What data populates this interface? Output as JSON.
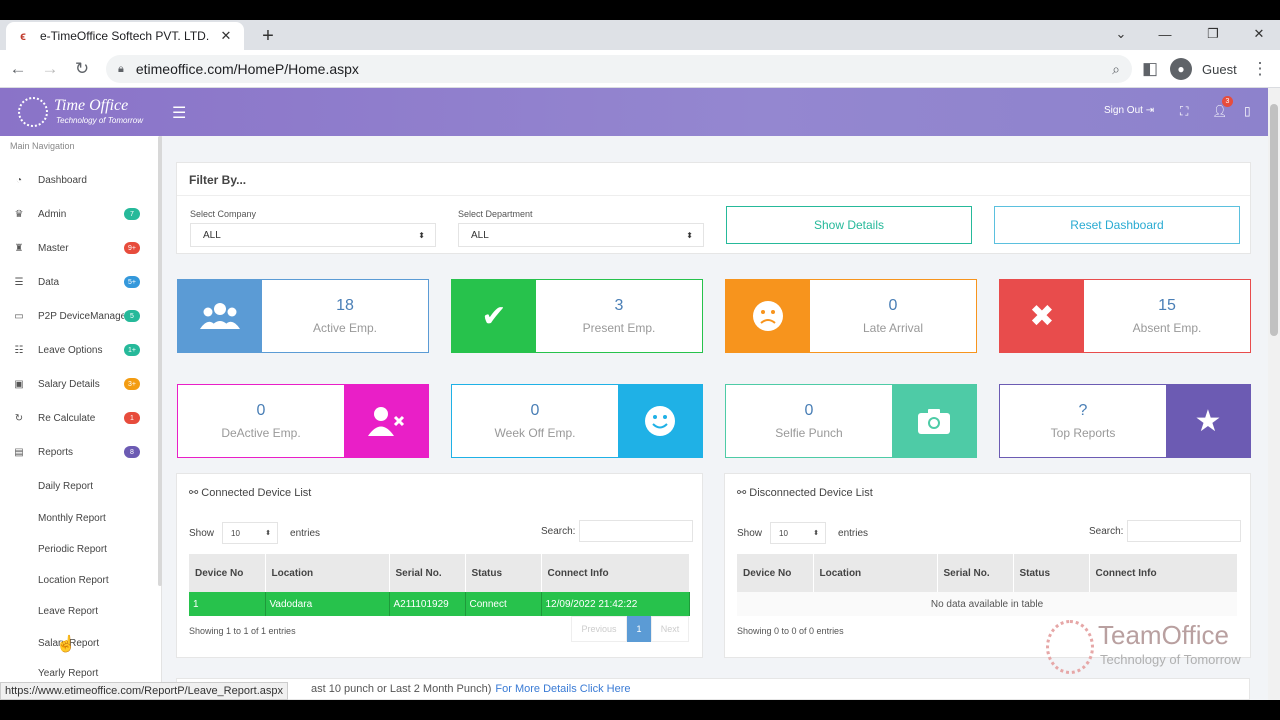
{
  "browser": {
    "tab_title": "e-TimeOffice Softech PVT. LTD.",
    "url": "etimeoffice.com/HomeP/Home.aspx",
    "profile_label": "Guest",
    "status_url": "https://www.etimeoffice.com/ReportP/Leave_Report.aspx"
  },
  "header": {
    "logo_name": "Time Office",
    "logo_tagline": "Technology of Tomorrow",
    "sign_out": "Sign Out",
    "notification_count": "3"
  },
  "sidebar": {
    "section_label": "Main Navigation",
    "items": [
      {
        "label": "Dashboard",
        "icon": "dashboard-icon",
        "count": ""
      },
      {
        "label": "Admin",
        "icon": "admin-icon",
        "count": "7",
        "color": "#26b99a"
      },
      {
        "label": "Master",
        "icon": "master-icon",
        "count": "9+",
        "color": "#e74c3c"
      },
      {
        "label": "Data",
        "icon": "database-icon",
        "count": "5+",
        "color": "#3498db"
      },
      {
        "label": "P2P DeviceManage",
        "icon": "monitor-icon",
        "count": "5",
        "color": "#26b99a"
      },
      {
        "label": "Leave Options",
        "icon": "list-icon",
        "count": "1+",
        "color": "#26b99a"
      },
      {
        "label": "Salary Details",
        "icon": "money-icon",
        "count": "3+",
        "color": "#f39c12"
      },
      {
        "label": "Re Calculate",
        "icon": "refresh-icon",
        "count": "1",
        "color": "#e74c3c"
      },
      {
        "label": "Reports",
        "icon": "report-icon",
        "count": "8",
        "color": "#6c5bb3"
      }
    ],
    "subitems": [
      "Daily Report",
      "Monthly Report",
      "Periodic Report",
      "Location Report",
      "Leave Report",
      "Salary Report",
      "Yearly Report"
    ]
  },
  "filter": {
    "title": "Filter By...",
    "company_label": "Select Company",
    "company_value": "ALL",
    "department_label": "Select Department",
    "department_value": "ALL",
    "show_details": "Show Details",
    "reset_dashboard": "Reset Dashboard"
  },
  "stats": [
    {
      "value": "18",
      "label": "Active Emp.",
      "color": "#5b9bd5",
      "icon": "users-icon"
    },
    {
      "value": "3",
      "label": "Present Emp.",
      "color": "#27c24c",
      "icon": "check-icon"
    },
    {
      "value": "0",
      "label": "Late Arrival",
      "color": "#f7941d",
      "icon": "frown-icon"
    },
    {
      "value": "15",
      "label": "Absent Emp.",
      "color": "#e84c4c",
      "icon": "x-icon"
    },
    {
      "value": "0",
      "label": "DeActive Emp.",
      "color": "#e91fc7",
      "icon": "user-remove-icon"
    },
    {
      "value": "0",
      "label": "Week Off Emp.",
      "color": "#1fb1e6",
      "icon": "smile-icon"
    },
    {
      "value": "0",
      "label": "Selfie Punch",
      "color": "#4ecba6",
      "icon": "camera-icon"
    },
    {
      "value": "?",
      "label": "Top Reports",
      "color": "#6c5bb3",
      "icon": "star-icon"
    }
  ],
  "connected": {
    "title": "Connected Device List",
    "show": "Show",
    "length": "10",
    "entries": "entries",
    "search": "Search:",
    "columns": [
      "Device No",
      "Location",
      "Serial No.",
      "Status",
      "Connect Info"
    ],
    "rows": [
      [
        "1",
        "Vadodara",
        "A211101929",
        "Connect",
        "12/09/2022 21:42:22"
      ]
    ],
    "info": "Showing 1 to 1 of 1 entries",
    "prev": "Previous",
    "page": "1",
    "next": "Next"
  },
  "disconnected": {
    "title": "Disconnected Device List",
    "show": "Show",
    "length": "10",
    "entries": "entries",
    "search": "Search:",
    "columns": [
      "Device No",
      "Location",
      "Serial No.",
      "Status",
      "Connect Info"
    ],
    "empty": "No data available in table",
    "info": "Showing 0 to 0 of 0 entries"
  },
  "bottom": {
    "text": "ast 10 punch or Last 2 Month Punch)",
    "link": "For More Details Click Here"
  },
  "watermark": {
    "name": "TeamOffice",
    "tagline": "Technology of Tomorrow"
  }
}
